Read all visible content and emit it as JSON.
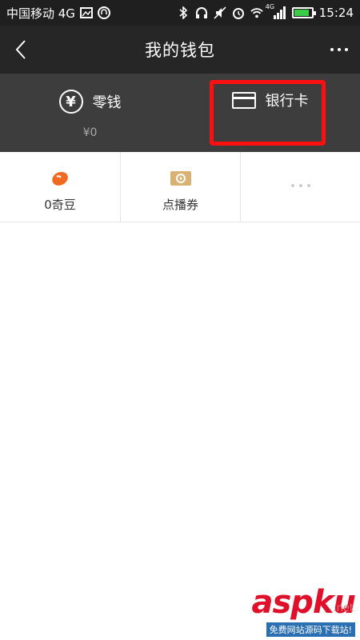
{
  "status_bar": {
    "carrier": "中国移动 4G",
    "network_tag": "4G",
    "time": "15:24",
    "battery_level": 0.85,
    "icons": [
      "image-icon",
      "headset-icon",
      "bluetooth-icon",
      "headphones-icon",
      "mute-icon",
      "alarm-icon",
      "wifi-icon",
      "signal-icon",
      "battery-icon"
    ]
  },
  "nav": {
    "title": "我的钱包",
    "back_icon": "chevron-left-icon",
    "more_icon": "more-dots-icon"
  },
  "wallet": {
    "change": {
      "label": "零钱",
      "balance": "¥0",
      "icon": "yen-circle-icon"
    },
    "bank_card": {
      "label": "银行卡",
      "icon": "card-icon"
    },
    "highlight_color": "#ff1010"
  },
  "grid": {
    "items": [
      {
        "label": "0奇豆",
        "icon": "bean-icon",
        "icon_color": "#f26a21"
      },
      {
        "label": "点播券",
        "icon": "ticket-icon",
        "icon_color": "#d9b273"
      },
      {
        "label": "",
        "icon": "more-dots-icon"
      }
    ]
  },
  "watermark": {
    "logo": "aspku",
    "domain": ".net",
    "tagline": "免费网站源码下载站!"
  },
  "colors": {
    "status_bg": "#1f1f1f",
    "nav_bg": "#262626",
    "panel_bg": "#3d3d3d",
    "accent_red": "#e0102a"
  }
}
